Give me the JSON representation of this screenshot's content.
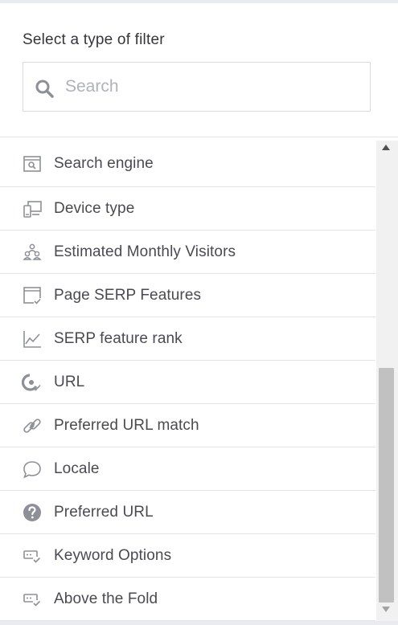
{
  "header": {
    "title": "Select a type of filter",
    "search_placeholder": "Search",
    "search_value": ""
  },
  "filters": [
    {
      "label": "Search engine",
      "icon": "search-engine-icon"
    },
    {
      "label": "Device type",
      "icon": "device-type-icon"
    },
    {
      "label": "Estimated Monthly Visitors",
      "icon": "visitors-icon"
    },
    {
      "label": "Page SERP Features",
      "icon": "serp-features-icon"
    },
    {
      "label": "SERP feature rank",
      "icon": "rank-chart-icon"
    },
    {
      "label": "URL",
      "icon": "url-icon"
    },
    {
      "label": "Preferred URL match",
      "icon": "link-match-icon"
    },
    {
      "label": "Locale",
      "icon": "speech-bubble-icon"
    },
    {
      "label": "Preferred URL",
      "icon": "question-icon"
    },
    {
      "label": "Keyword Options",
      "icon": "keyword-options-icon"
    },
    {
      "label": "Above the Fold",
      "icon": "above-fold-icon"
    }
  ],
  "colors": {
    "icon": "#8e9099",
    "text": "#4a4a52",
    "border": "#e3e4e8",
    "placeholder": "#b0b2ba"
  }
}
